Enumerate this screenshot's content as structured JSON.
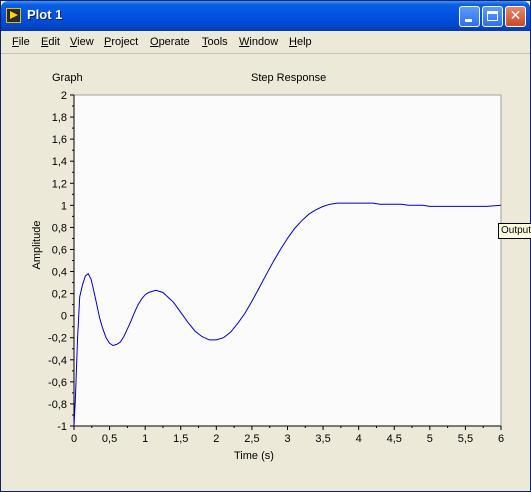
{
  "window": {
    "title": "Plot 1"
  },
  "menu": [
    "File",
    "Edit",
    "View",
    "Project",
    "Operate",
    "Tools",
    "Window",
    "Help"
  ],
  "graph_label": "Graph",
  "chart_data": {
    "type": "line",
    "title": "Step Response",
    "xlabel": "Time (s)",
    "ylabel": "Amplitude",
    "xlim": [
      0,
      6
    ],
    "ylim": [
      -1,
      2
    ],
    "x_ticks": [
      "0",
      "0,5",
      "1",
      "1,5",
      "2",
      "2,5",
      "3",
      "3,5",
      "4",
      "4,5",
      "5",
      "5,5",
      "6"
    ],
    "y_ticks": [
      "-1",
      "-0,8",
      "-0,6",
      "-0,4",
      "-0,2",
      "0",
      "0,2",
      "0,4",
      "0,6",
      "0,8",
      "1",
      "1,2",
      "1,4",
      "1,6",
      "1,8",
      "2"
    ],
    "color": "#0000c8",
    "series": [
      {
        "name": "Output",
        "x": [
          0,
          0.02,
          0.05,
          0.08,
          0.12,
          0.16,
          0.2,
          0.24,
          0.28,
          0.32,
          0.36,
          0.4,
          0.45,
          0.5,
          0.55,
          0.6,
          0.65,
          0.7,
          0.75,
          0.8,
          0.85,
          0.9,
          0.95,
          1.0,
          1.05,
          1.1,
          1.15,
          1.2,
          1.25,
          1.3,
          1.35,
          1.4,
          1.5,
          1.6,
          1.7,
          1.8,
          1.9,
          2.0,
          2.1,
          2.2,
          2.3,
          2.4,
          2.5,
          2.6,
          2.7,
          2.8,
          2.9,
          3.0,
          3.1,
          3.2,
          3.3,
          3.4,
          3.5,
          3.6,
          3.7,
          3.8,
          3.9,
          4.0,
          4.1,
          4.2,
          4.3,
          4.4,
          4.5,
          4.6,
          4.7,
          4.8,
          4.9,
          5.0,
          5.2,
          5.4,
          5.6,
          5.8,
          6.0
        ],
        "y": [
          -1.0,
          -0.75,
          -0.2,
          0.17,
          0.28,
          0.36,
          0.38,
          0.33,
          0.22,
          0.1,
          -0.02,
          -0.11,
          -0.2,
          -0.25,
          -0.27,
          -0.26,
          -0.24,
          -0.19,
          -0.12,
          -0.05,
          0.03,
          0.1,
          0.15,
          0.19,
          0.21,
          0.22,
          0.23,
          0.22,
          0.21,
          0.18,
          0.15,
          0.12,
          0.03,
          -0.06,
          -0.14,
          -0.19,
          -0.22,
          -0.22,
          -0.2,
          -0.15,
          -0.07,
          0.02,
          0.13,
          0.25,
          0.37,
          0.49,
          0.6,
          0.7,
          0.79,
          0.86,
          0.92,
          0.96,
          0.99,
          1.01,
          1.02,
          1.02,
          1.02,
          1.02,
          1.02,
          1.02,
          1.01,
          1.01,
          1.01,
          1.01,
          1.0,
          1.0,
          1.0,
          0.99,
          0.99,
          0.99,
          0.99,
          0.99,
          1.0
        ]
      }
    ]
  }
}
